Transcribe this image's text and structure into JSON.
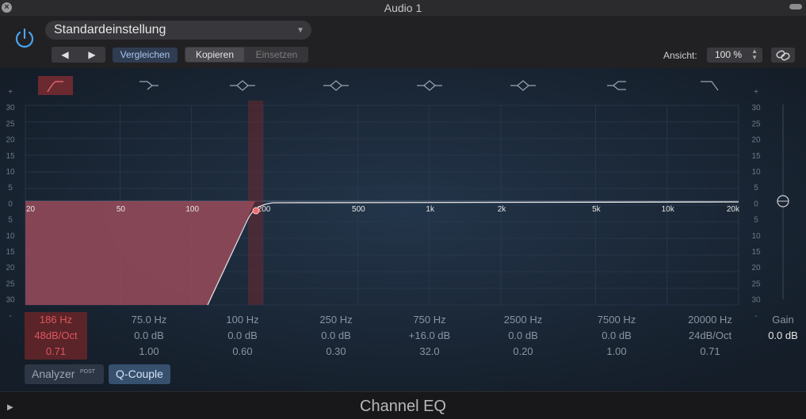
{
  "window": {
    "title": "Audio 1"
  },
  "header": {
    "preset": "Standardeinstellung",
    "prev_icon": "◀",
    "next_icon": "▶",
    "compare_label": "Vergleichen",
    "copy_label": "Kopieren",
    "paste_label": "Einsetzen",
    "view_label": "Ansicht:",
    "view_value": "100 %"
  },
  "band_icons": [
    "low-cut-icon",
    "low-shelf-icon",
    "peak-icon",
    "peak-icon",
    "peak-icon",
    "peak-icon",
    "high-shelf-icon",
    "high-cut-icon"
  ],
  "db_scale": [
    "+",
    "30",
    "25",
    "20",
    "15",
    "10",
    "5",
    "0",
    "5",
    "10",
    "15",
    "20",
    "25",
    "30",
    "-"
  ],
  "freq_labels": [
    "20",
    "50",
    "100",
    "200",
    "500",
    "1k",
    "2k",
    "5k",
    "10k",
    "20k"
  ],
  "bands": [
    {
      "freq": "186 Hz",
      "gain": "48dB/Oct",
      "q": "0.71"
    },
    {
      "freq": "75.0 Hz",
      "gain": "0.0 dB",
      "q": "1.00"
    },
    {
      "freq": "100 Hz",
      "gain": "0.0 dB",
      "q": "0.60"
    },
    {
      "freq": "250 Hz",
      "gain": "0.0 dB",
      "q": "0.30"
    },
    {
      "freq": "750 Hz",
      "gain": "+16.0 dB",
      "q": "32.0"
    },
    {
      "freq": "2500 Hz",
      "gain": "0.0 dB",
      "q": "0.20"
    },
    {
      "freq": "7500 Hz",
      "gain": "0.0 dB",
      "q": "1.00"
    },
    {
      "freq": "20000 Hz",
      "gain": "24dB/Oct",
      "q": "0.71"
    }
  ],
  "gain_column": {
    "label": "Gain",
    "value": "0.0 dB"
  },
  "buttons": {
    "analyzer": "Analyzer",
    "analyzer_badge": "POST",
    "q_couple": "Q-Couple"
  },
  "footer": {
    "title": "Channel EQ"
  },
  "colors": {
    "accent_red": "#e05560",
    "background": "#1a2636",
    "selected_blue": "#36506e"
  }
}
